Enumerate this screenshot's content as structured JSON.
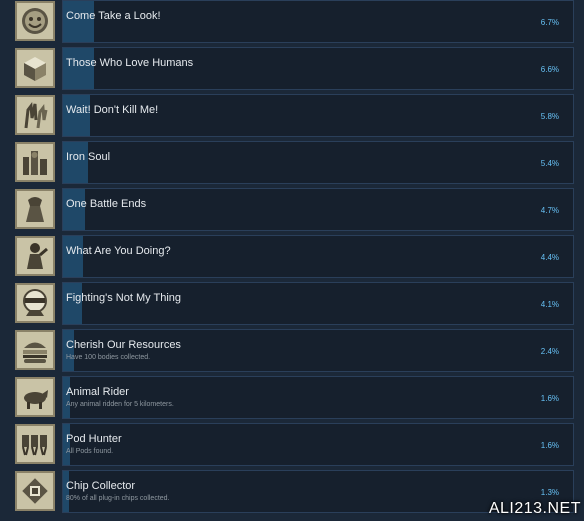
{
  "achievements": [
    {
      "title": "Come Take a Look!",
      "desc": "",
      "percent_label": "6.7%",
      "percent": 6.7,
      "icon": "smiling-face-icon"
    },
    {
      "title": "Those Who Love Humans",
      "desc": "",
      "percent_label": "6.6%",
      "percent": 6.6,
      "icon": "cube-stack-icon"
    },
    {
      "title": "Wait! Don't Kill Me!",
      "desc": "",
      "percent_label": "5.8%",
      "percent": 5.8,
      "icon": "raised-hands-icon"
    },
    {
      "title": "Iron Soul",
      "desc": "",
      "percent_label": "5.4%",
      "percent": 5.4,
      "icon": "factory-icon"
    },
    {
      "title": "One Battle Ends",
      "desc": "",
      "percent_label": "4.7%",
      "percent": 4.7,
      "icon": "robot-silhouette-icon"
    },
    {
      "title": "What Are You Doing?",
      "desc": "",
      "percent_label": "4.4%",
      "percent": 4.4,
      "icon": "figure-silhouette-icon"
    },
    {
      "title": "Fighting's Not My Thing",
      "desc": "",
      "percent_label": "4.1%",
      "percent": 4.1,
      "icon": "masked-face-icon"
    },
    {
      "title": "Cherish Our Resources",
      "desc": "Have 100 bodies collected.",
      "percent_label": "2.4%",
      "percent": 2.4,
      "icon": "burger-icon"
    },
    {
      "title": "Animal Rider",
      "desc": "Any animal ridden for 5 kilometers.",
      "percent_label": "1.6%",
      "percent": 1.6,
      "icon": "boar-icon"
    },
    {
      "title": "Pod Hunter",
      "desc": "All Pods found.",
      "percent_label": "1.6%",
      "percent": 1.6,
      "icon": "pods-icon"
    },
    {
      "title": "Chip Collector",
      "desc": "80% of all plug-in chips collected.",
      "percent_label": "1.3%",
      "percent": 1.3,
      "icon": "chip-icon"
    }
  ],
  "watermark": "ALI213.NET",
  "colors": {
    "background": "#1b2838",
    "bar": "#1f4868",
    "percent": "#67c1f5",
    "icon_bg": "#c9c3a6"
  }
}
